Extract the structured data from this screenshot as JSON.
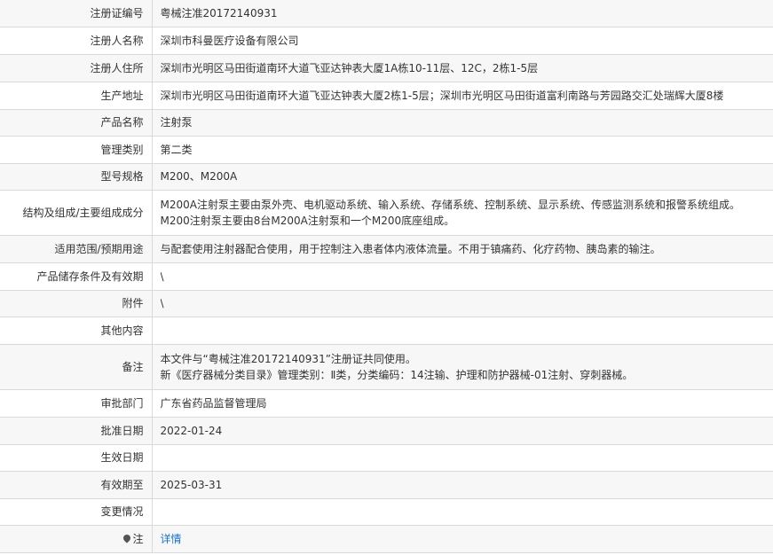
{
  "rows": [
    {
      "label": "注册证编号",
      "value": [
        "粤械注准20172140931"
      ]
    },
    {
      "label": "注册人名称",
      "value": [
        "深圳市科曼医疗设备有限公司"
      ]
    },
    {
      "label": "注册人住所",
      "value": [
        "深圳市光明区马田街道南环大道飞亚达钟表大厦1A栋10-11层、12C，2栋1-5层"
      ]
    },
    {
      "label": "生产地址",
      "value": [
        "深圳市光明区马田街道南环大道飞亚达钟表大厦2栋1-5层；深圳市光明区马田街道富利南路与芳园路交汇处瑞辉大厦8楼"
      ]
    },
    {
      "label": "产品名称",
      "value": [
        "注射泵"
      ]
    },
    {
      "label": "管理类别",
      "value": [
        "第二类"
      ]
    },
    {
      "label": "型号规格",
      "value": [
        "M200、M200A"
      ]
    },
    {
      "label": "结构及组成/主要组成成分",
      "value": [
        "M200A注射泵主要由泵外壳、电机驱动系统、输入系统、存储系统、控制系统、显示系统、传感监测系统和报警系统组成。",
        "M200注射泵主要由8台M200A注射泵和一个M200底座组成。"
      ]
    },
    {
      "label": "适用范围/预期用途",
      "value": [
        "与配套使用注射器配合使用，用于控制注入患者体内液体流量。不用于镇痛药、化疗药物、胰岛素的输注。"
      ]
    },
    {
      "label": "产品储存条件及有效期",
      "value": [
        "\\"
      ]
    },
    {
      "label": "附件",
      "value": [
        "\\"
      ]
    },
    {
      "label": "其他内容",
      "value": [
        ""
      ]
    },
    {
      "label": "备注",
      "value": [
        "本文件与“粤械注准20172140931”注册证共同使用。",
        "新《医疗器械分类目录》管理类别：Ⅱ类，分类编码：14注输、护理和防护器械-01注射、穿刺器械。"
      ]
    },
    {
      "label": "审批部门",
      "value": [
        "广东省药品监督管理局"
      ]
    },
    {
      "label": "批准日期",
      "value": [
        "2022-01-24"
      ]
    },
    {
      "label": "生效日期",
      "value": [
        ""
      ]
    },
    {
      "label": "有效期至",
      "value": [
        "2025-03-31"
      ]
    },
    {
      "label": "变更情况",
      "value": [
        ""
      ]
    }
  ],
  "note_row": {
    "icon": "pin-icon",
    "label": "注",
    "link_text": "详情",
    "link_color": "#1a73c8"
  }
}
